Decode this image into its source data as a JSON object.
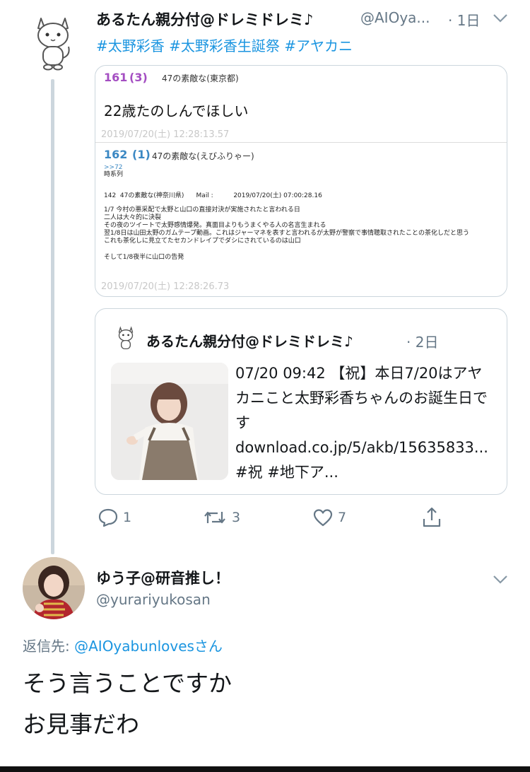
{
  "tweet1": {
    "display_name": "あるたん親分付@ドレミドレミ♪",
    "handle": "@AIOya...",
    "time": "· 1日",
    "hashtags": "#太野彩香 #太野彩香生誕祭 #アヤカニ",
    "avatar_icon": "cat-mascot-icon",
    "screenshot": {
      "post1": {
        "number": "161",
        "count": "(3)",
        "poster": "47の素敵な(東京都)",
        "body": "22歳たのしんでほしい",
        "timestamp": "2019/07/20(土) 12:28:13.57"
      },
      "post2": {
        "number": "162",
        "count": "(1)",
        "poster": "47の素敵な(えびふりゃー)",
        "reply_link": ">>72",
        "label": "時系列",
        "header_line": "142  47の素敵な(神奈川県)      Mail :          2019/07/20(土) 07:00:28.16",
        "lines": [
          "1/7 今村の悪采配で太野と山口の直接対決が実施されたと言われる日",
          "二人は大々的に決裂",
          "その夜のツイートで太野感情爆発。真面目よりもうまくやる人の名言生まれる",
          "翌1/8日は山田太野のガムテープ動画。これはジャーマネを表すと言われるが太野が警察で事情聴取されたことの茶化しだと思う",
          "これも茶化しに見立てたセカンドレイプでダシにされているのは山口"
        ],
        "last_line": "そして1/8夜半に山口の告発",
        "timestamp": "2019/07/20(土) 12:28:26.73"
      }
    },
    "quote": {
      "display_name": "あるたん親分付@ドレミドレミ♪",
      "time": "· 2日",
      "text": "07/20 09:42 【祝】本日7/20はアヤカニこと太野彩香ちゃんのお誕生日です download.co.jp/5/akb/15635833... #祝 #地下ア..."
    },
    "actions": {
      "reply_count": "1",
      "retweet_count": "3",
      "like_count": "7"
    }
  },
  "tweet2": {
    "display_name": "ゆう子@研音推し！",
    "handle": "@yurariyukosan",
    "reply_to_label": "返信先:",
    "reply_to_handle": "@AIOyabunlovesさん",
    "text_line1": "そう言うことですか",
    "text_line2": "お見事だわ"
  },
  "colors": {
    "link": "#1b95e0",
    "grey": "#657786",
    "border": "#ccd6dd",
    "purple_number": "#a44ec2",
    "blue_number": "#3b88c3"
  }
}
